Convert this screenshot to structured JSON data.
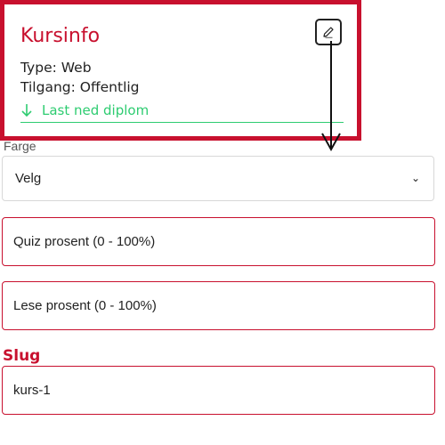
{
  "card": {
    "title": "Kursinfo",
    "type_line": "Type: Web",
    "access_line": "Tilgang: Offentlig",
    "download_label": "Last ned diplom",
    "edit_icon": "pencil-icon",
    "download_icon": "arrow-down-icon"
  },
  "form": {
    "color_label": "Farge",
    "color_select_value": "Velg",
    "quiz_placeholder": "Quiz prosent (0 - 100%)",
    "reading_placeholder": "Lese prosent (0 - 100%)",
    "slug_label": "Slug",
    "slug_value": "kurs-1"
  },
  "colors": {
    "brand_red": "#c8102e",
    "success_green": "#2ecc71",
    "text": "#222222"
  }
}
